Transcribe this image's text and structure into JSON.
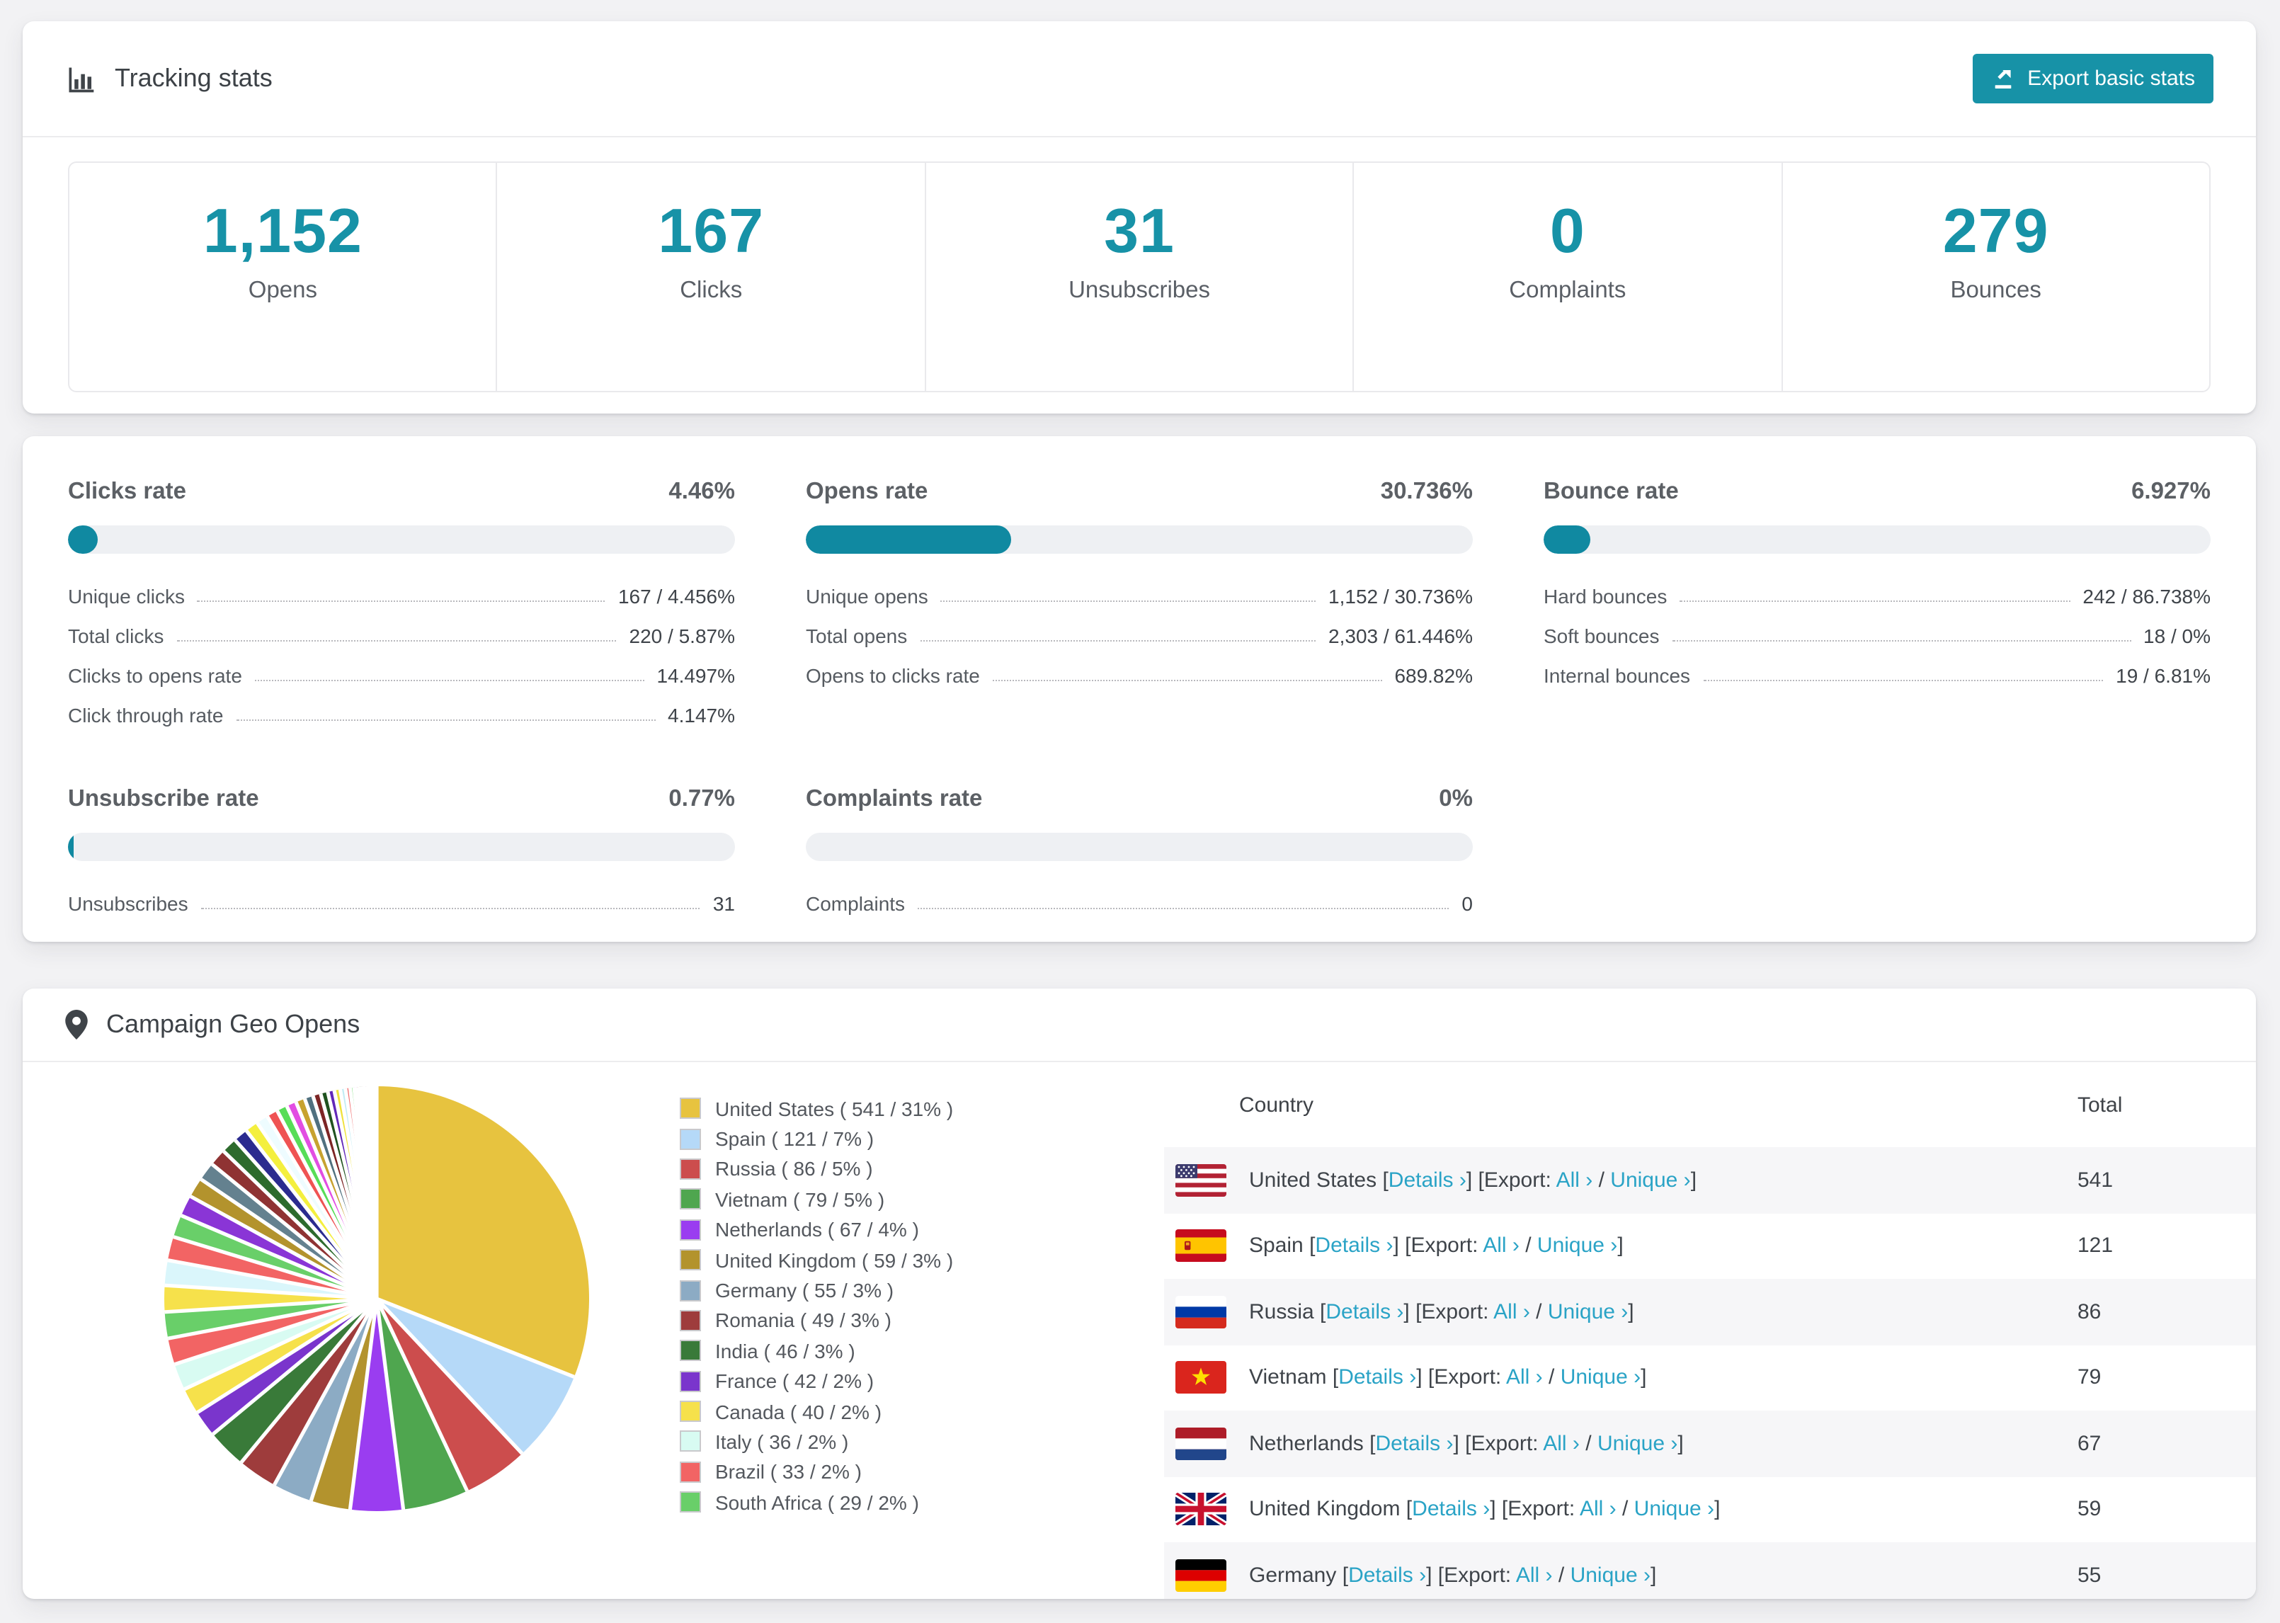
{
  "colors": {
    "accent": "#1792a7",
    "bar_fill": "#1089a1",
    "link": "#2aa3c6"
  },
  "header": {
    "title": "Tracking stats",
    "export_label": "Export basic stats"
  },
  "stats": {
    "items": [
      {
        "value": "1,152",
        "label": "Opens"
      },
      {
        "value": "167",
        "label": "Clicks"
      },
      {
        "value": "31",
        "label": "Unsubscribes"
      },
      {
        "value": "0",
        "label": "Complaints"
      },
      {
        "value": "279",
        "label": "Bounces"
      }
    ]
  },
  "rates": {
    "blocks": [
      {
        "title": "Clicks rate",
        "value": "4.46%",
        "percent": 4.46,
        "rows": [
          {
            "label": "Unique clicks",
            "value": "167 / 4.456%"
          },
          {
            "label": "Total clicks",
            "value": "220 / 5.87%"
          },
          {
            "label": "Clicks to opens rate",
            "value": "14.497%"
          },
          {
            "label": "Click through rate",
            "value": "4.147%"
          }
        ]
      },
      {
        "title": "Opens rate",
        "value": "30.736%",
        "percent": 30.736,
        "rows": [
          {
            "label": "Unique opens",
            "value": "1,152 / 30.736%"
          },
          {
            "label": "Total opens",
            "value": "2,303 / 61.446%"
          },
          {
            "label": "Opens to clicks rate",
            "value": "689.82%"
          }
        ]
      },
      {
        "title": "Bounce rate",
        "value": "6.927%",
        "percent": 6.927,
        "rows": [
          {
            "label": "Hard bounces",
            "value": "242 / 86.738%"
          },
          {
            "label": "Soft bounces",
            "value": "18 / 0%"
          },
          {
            "label": "Internal bounces",
            "value": "19 / 6.81%"
          }
        ]
      },
      {
        "title": "Unsubscribe rate",
        "value": "0.77%",
        "percent": 0.77,
        "rows": [
          {
            "label": "Unsubscribes",
            "value": "31"
          }
        ]
      },
      {
        "title": "Complaints rate",
        "value": "0%",
        "percent": 0,
        "rows": [
          {
            "label": "Complaints",
            "value": "0"
          }
        ]
      }
    ]
  },
  "geo": {
    "title": "Campaign Geo Opens",
    "chart_data": {
      "type": "pie",
      "title": "Campaign Geo Opens",
      "unit": "opens",
      "start_angle_deg": -90,
      "direction": "clockwise",
      "legend_position": "right",
      "slices": [
        {
          "label": "United States",
          "value": 541,
          "percent": 31,
          "color": "#e7c33f"
        },
        {
          "label": "Spain",
          "value": 121,
          "percent": 7,
          "color": "#b5d9f8"
        },
        {
          "label": "Russia",
          "value": 86,
          "percent": 5,
          "color": "#cc4d4d"
        },
        {
          "label": "Vietnam",
          "value": 79,
          "percent": 5,
          "color": "#4fa64f"
        },
        {
          "label": "Netherlands",
          "value": 67,
          "percent": 4,
          "color": "#9a3df0"
        },
        {
          "label": "United Kingdom",
          "value": 59,
          "percent": 3,
          "color": "#b3932d"
        },
        {
          "label": "Germany",
          "value": 55,
          "percent": 3,
          "color": "#8cabc4"
        },
        {
          "label": "Romania",
          "value": 49,
          "percent": 3,
          "color": "#9e3c3c"
        },
        {
          "label": "India",
          "value": 46,
          "percent": 3,
          "color": "#397a39"
        },
        {
          "label": "France",
          "value": 42,
          "percent": 2,
          "color": "#7a35cc"
        },
        {
          "label": "Canada",
          "value": 40,
          "percent": 2,
          "color": "#f6e14b"
        },
        {
          "label": "Italy",
          "value": 36,
          "percent": 2,
          "color": "#d8fbf2"
        },
        {
          "label": "Brazil",
          "value": 33,
          "percent": 2,
          "color": "#f26464"
        },
        {
          "label": "South Africa",
          "value": 29,
          "percent": 2,
          "color": "#69cf69"
        }
      ],
      "others_tail": {
        "note": "unlabeled small slices, sizes estimated from pixels",
        "percents": [
          2,
          1.9,
          1.8,
          1.7,
          1.6,
          1.5,
          1.4,
          1.3,
          1.2,
          1.1,
          1,
          0.9,
          0.85,
          0.8,
          0.75,
          0.7,
          0.65,
          0.6,
          0.55,
          0.5,
          0.45,
          0.4,
          0.35,
          0.3,
          0.25,
          0.2,
          0.15,
          0.12,
          0.1,
          0.08,
          0.06,
          0.05
        ],
        "colors": [
          "#f6e14b",
          "#daf6fb",
          "#f26464",
          "#69cf69",
          "#8a35d6",
          "#b3932d",
          "#64818f",
          "#8f3333",
          "#2d6b2d",
          "#2b2b8f",
          "#f4ef3e",
          "#eefcff",
          "#ef5353",
          "#57dd57",
          "#e24de2",
          "#c7a22f",
          "#50707f",
          "#7c2525",
          "#1f521f",
          "#6128b8",
          "#efe23c",
          "#c2ecf4",
          "#ef6b6b",
          "#66d966",
          "#d24fe8",
          "#b08c2a",
          "#48616f",
          "#992f2f",
          "#265426",
          "#5a1fa0",
          "#e8d83a",
          "#ff9dff"
        ]
      }
    },
    "legend_format": {
      "open": "( ",
      "slash": " / ",
      "close": "% )"
    },
    "table": {
      "columns": [
        "Country",
        "Total"
      ],
      "link_labels": {
        "bracket_open": "[",
        "bracket_close": "]",
        "details": "Details ›",
        "export_prefix": "Export:",
        "all": "All ›",
        "slash": " / ",
        "unique": "Unique ›"
      },
      "rows": [
        {
          "flag": "us",
          "country": "United States",
          "total": "541"
        },
        {
          "flag": "es",
          "country": "Spain",
          "total": "121"
        },
        {
          "flag": "ru",
          "country": "Russia",
          "total": "86"
        },
        {
          "flag": "vn",
          "country": "Vietnam",
          "total": "79"
        },
        {
          "flag": "nl",
          "country": "Netherlands",
          "total": "67"
        },
        {
          "flag": "gb",
          "country": "United Kingdom",
          "total": "59"
        },
        {
          "flag": "de",
          "country": "Germany",
          "total": "55"
        }
      ]
    }
  }
}
